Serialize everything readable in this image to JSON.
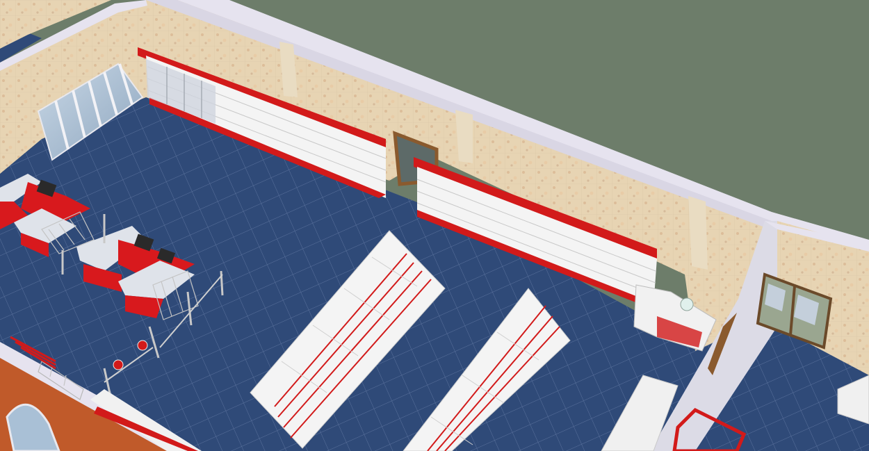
{
  "scene": {
    "subject": "3d-supermarket-floor-plan",
    "colors": {
      "background": "#6d7d6a",
      "floor": "#2f4a78",
      "floor_grid": "#8fa2c4",
      "wall_top": "#e6e3ef",
      "wall_face": "#e6d2b0",
      "shelf_white": "#f4f4f4",
      "shelf_red": "#d21a1a",
      "checkout_red": "#d8191d",
      "glass": "#a9c0d6",
      "brick": "#c05a2a",
      "door_frame": "#8a5a2e"
    }
  }
}
